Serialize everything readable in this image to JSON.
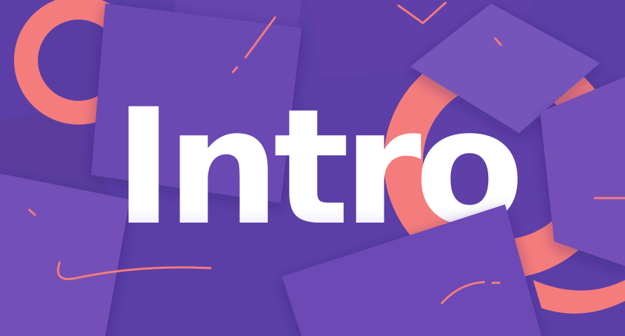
{
  "title": {
    "text": "Intro"
  },
  "colors": {
    "background": "#5b3fa6",
    "panel_light": "#7450b8",
    "panel_mid": "#6a48b2",
    "panel_dark": "#5a3d9e",
    "coral": "#f47c7c",
    "text": "#ffffff",
    "text_shade": "#cbb9ec"
  },
  "icons": {
    "ring_top_left": "ring-icon",
    "ring_right": "ring-icon",
    "stroke": "squiggle-icon"
  }
}
